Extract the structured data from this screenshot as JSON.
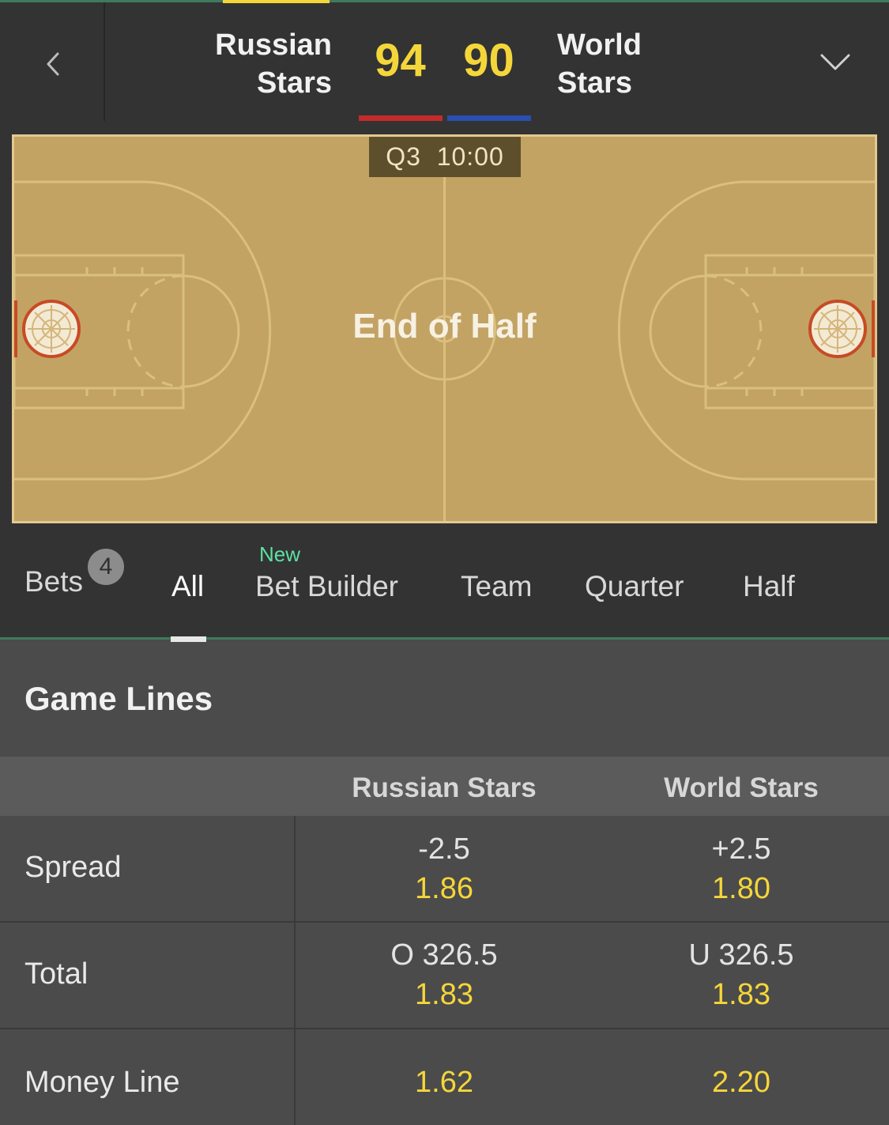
{
  "match": {
    "home_team_line1": "Russian",
    "home_team_line2": "Stars",
    "away_team_line1": "World",
    "away_team_line2": "Stars",
    "home_score": "94",
    "away_score": "90",
    "home_color": "#c52b2b",
    "away_color": "#2a4fb0"
  },
  "court": {
    "period": "Q3",
    "time": "10:00",
    "status": "End of Half"
  },
  "tabs": {
    "bets": "Bets",
    "bets_count": "4",
    "new_label": "New",
    "items": [
      "All",
      "Bet Builder",
      "Team",
      "Quarter",
      "Half"
    ],
    "active": "All"
  },
  "game_lines": {
    "title": "Game Lines",
    "columns": [
      "Russian Stars",
      "World Stars"
    ],
    "rows": [
      {
        "market": "Spread",
        "home": {
          "line": "-2.5",
          "odds": "1.86"
        },
        "away": {
          "line": "+2.5",
          "odds": "1.80"
        }
      },
      {
        "market": "Total",
        "home": {
          "line": "O 326.5",
          "odds": "1.83"
        },
        "away": {
          "line": "U 326.5",
          "odds": "1.83"
        }
      },
      {
        "market": "Money Line",
        "home": {
          "odds": "1.62"
        },
        "away": {
          "odds": "2.20"
        }
      }
    ]
  },
  "icons": {
    "back": "chevron-left-icon",
    "expand": "chevron-down-icon",
    "hoop": "basketball-hoop-icon"
  },
  "colors": {
    "accent": "#f5d63a",
    "new_label": "#5fe0a4",
    "court_floor": "#c2a364",
    "divider_green": "#3e7a5c"
  }
}
